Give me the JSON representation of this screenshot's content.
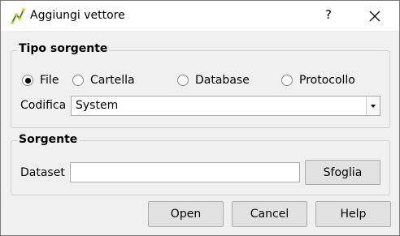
{
  "window": {
    "title": "Aggiungi vettore",
    "help_label": "?"
  },
  "source_type": {
    "group_title": "Tipo sorgente",
    "options": [
      {
        "label": "File",
        "checked": true
      },
      {
        "label": "Cartella",
        "checked": false
      },
      {
        "label": "Database",
        "checked": false
      },
      {
        "label": "Protocollo",
        "checked": false
      }
    ],
    "encoding_label": "Codifica",
    "encoding_value": "System"
  },
  "source": {
    "group_title": "Sorgente",
    "dataset_label": "Dataset",
    "dataset_value": "",
    "browse_label": "Sfoglia"
  },
  "footer": {
    "open_label": "Open",
    "cancel_label": "Cancel",
    "help_label": "Help"
  },
  "icons": {
    "app": "qgis-vector-icon",
    "close": "close-icon",
    "dropdown": "chevron-down-icon"
  }
}
